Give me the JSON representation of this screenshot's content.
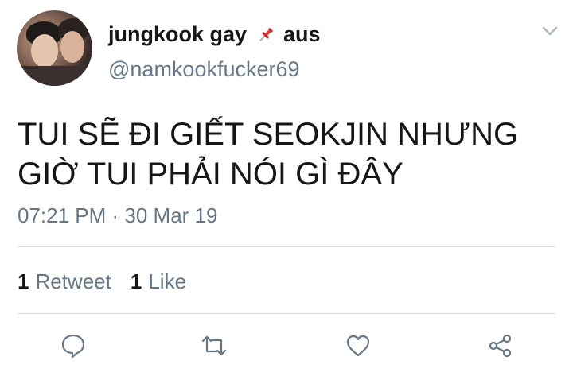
{
  "tweet": {
    "author": {
      "display_name": "jungkook gay",
      "pin_icon": "pushpin-icon",
      "location_tag": "aus",
      "handle": "@namkookfucker69"
    },
    "text_line1": "TUI SẼ ĐI GIẾT SEOKJIN NHƯNG",
    "text_line2": "GIỜ TUI PHẢI NÓI GÌ ĐÂY",
    "timestamp": "07:21 PM · 30 Mar 19",
    "stats": {
      "retweet_count": "1",
      "retweet_label": "Retweet",
      "like_count": "1",
      "like_label": "Like"
    }
  },
  "actions": [
    "reply-icon",
    "retweet-icon",
    "like-icon",
    "share-icon"
  ],
  "colors": {
    "text_primary": "#14171a",
    "text_secondary": "#657786",
    "divider": "#d8dee3"
  }
}
